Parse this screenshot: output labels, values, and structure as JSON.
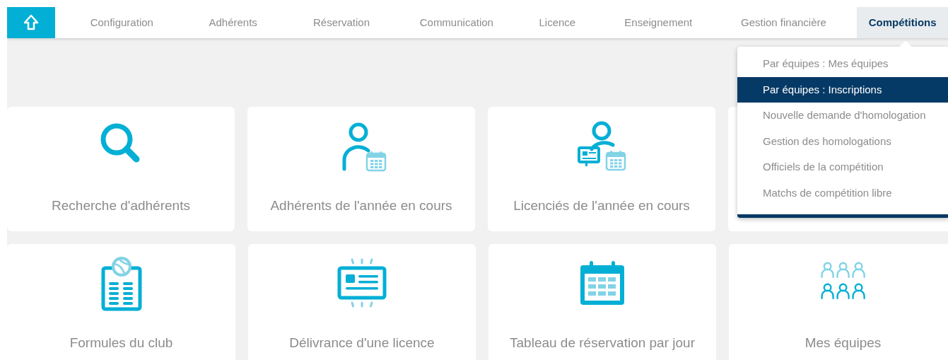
{
  "nav": {
    "tabs": [
      {
        "label": "Configuration",
        "selected": false
      },
      {
        "label": "Adhérents",
        "selected": false
      },
      {
        "label": "Réservation",
        "selected": false
      },
      {
        "label": "Communication",
        "selected": false
      },
      {
        "label": "Licence",
        "selected": false
      },
      {
        "label": "Enseignement",
        "selected": false
      },
      {
        "label": "Gestion financière",
        "selected": false
      },
      {
        "label": "Compétitions",
        "selected": true
      }
    ]
  },
  "dropdown": {
    "items": [
      {
        "label": "Par équipes : Mes équipes",
        "selected": false
      },
      {
        "label": "Par équipes : Inscriptions",
        "selected": true
      },
      {
        "label": "Nouvelle demande d'homologation",
        "selected": false
      },
      {
        "label": "Gestion des homologations",
        "selected": false
      },
      {
        "label": "Officiels de la compétition",
        "selected": false
      },
      {
        "label": "Matchs de compétition libre",
        "selected": false
      }
    ]
  },
  "cards": [
    {
      "label": "Recherche d'adhérents"
    },
    {
      "label": "Adhérents de l'année en cours"
    },
    {
      "label": "Licenciés de l'année en cours"
    },
    {
      "label": "Formules du club"
    },
    {
      "label": "Délivrance d'une licence"
    },
    {
      "label": "Tableau de réservation par jour"
    },
    {
      "label": "Mes équipes"
    }
  ]
}
